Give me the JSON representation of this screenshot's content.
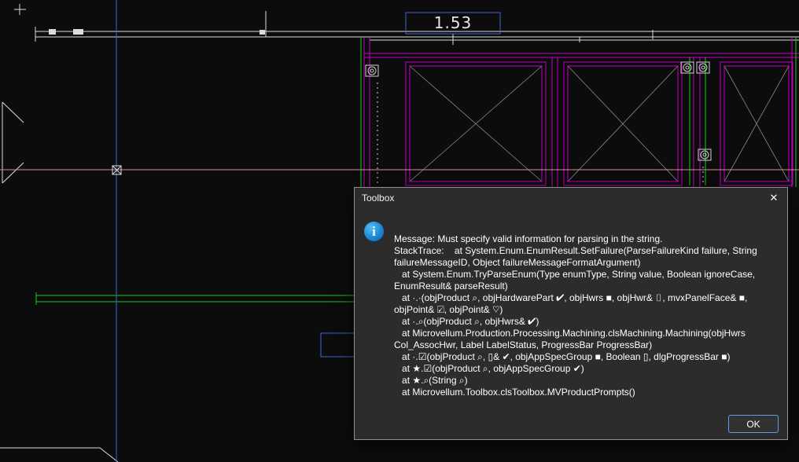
{
  "window": {
    "background": "#0c0c0c"
  },
  "drawing": {
    "dimension_label": "1.53",
    "colors": {
      "geometry_white": "#dcdcdc",
      "frame_magenta": "#c400c4",
      "band_green": "#17c917",
      "reference_blue": "#3b66cc",
      "reference_pink": "#d09090",
      "brace_gray": "#8a8a8a"
    }
  },
  "dialog": {
    "title": "Toolbox",
    "close_glyph": "✕",
    "info_glyph": "i",
    "message_text": "Message: Must specify valid information for parsing in the string.\nStackTrace:    at System.Enum.EnumResult.SetFailure(ParseFailureKind failure, String failureMessageID, Object failureMessageFormatArgument)\n   at System.Enum.TryParseEnum(Type enumType, String value, Boolean ignoreCase, EnumResult& parseResult)\n   at ·.·(objProduct ⌕, objHardwarePart ✔, objHwrs ■, objHwr& ▯, mvxPanelFace& ■, objPoint& ☑, objPoint& ♡)\n   at ·.⌕(objProduct ⌕, objHwrs& ✔)\n   at Microvellum.Production.Processing.Machining.clsMachining.Machining(objHwrs Col_AssocHwr, Label LabelStatus, ProgressBar ProgressBar)\n   at ·.☑(objProduct ⌕, ▯& ✔, objAppSpecGroup ■, Boolean ▯, dlgProgressBar ■)\n   at ★.☑(objProduct ⌕, objAppSpecGroup ✔)\n   at ★.⌕(String ⌕)\n   at Microvellum.Toolbox.clsToolbox.MVProductPrompts()",
    "ok_label": "OK"
  }
}
